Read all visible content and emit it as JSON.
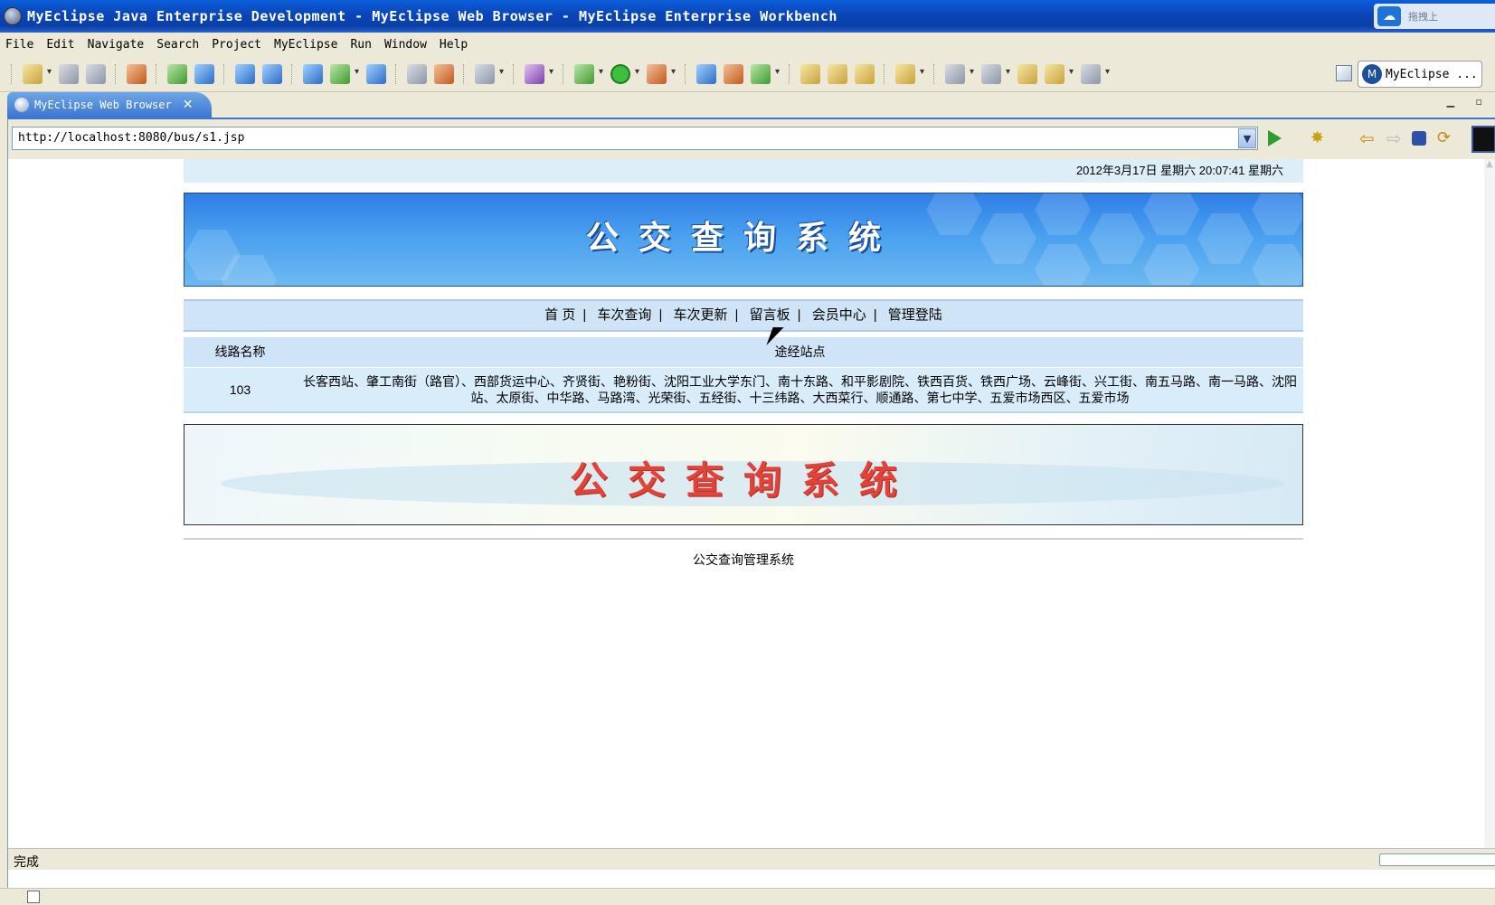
{
  "window": {
    "title": "MyEclipse Java Enterprise Development - MyEclipse Web Browser - MyEclipse Enterprise Workbench",
    "tray_text": "拖拽上"
  },
  "menu": [
    {
      "label": "File"
    },
    {
      "label": "Edit"
    },
    {
      "label": "Navigate"
    },
    {
      "label": "Search"
    },
    {
      "label": "Project"
    },
    {
      "label": "MyEclipse"
    },
    {
      "label": "Run"
    },
    {
      "label": "Window"
    },
    {
      "label": "Help"
    }
  ],
  "toolbar": {
    "perspective_label": "MyEclipse ...",
    "perspective_icon": "M"
  },
  "editor_tab": {
    "label": "MyEclipse Web Browser",
    "close": "✕"
  },
  "browser": {
    "url": "http://localhost:8080/bus/s1.jsp",
    "status": "完成"
  },
  "page": {
    "datetime": "2012年3月17日 星期六 20:07:41 星期六",
    "banner_title": "公交查询系统",
    "nav": [
      {
        "label": "首 页"
      },
      {
        "label": "车次查询"
      },
      {
        "label": "车次更新"
      },
      {
        "label": "留言板"
      },
      {
        "label": "会员中心"
      },
      {
        "label": "管理登陆"
      }
    ],
    "table": {
      "headers": [
        "线路名称",
        "途经站点"
      ],
      "rows": [
        {
          "name": "103",
          "stops": "长客西站、肇工南街（路官）、西部货运中心、齐贤街、艳粉街、沈阳工业大学东门、南十东路、和平影剧院、铁西百货、铁西广场、云峰街、兴工街、南五马路、南一马路、沈阳站、太原街、中华路、马路湾、光荣街、五经街、十三纬路、大西菜行、顺通路、第七中学、五爱市场西区、五爱市场"
        }
      ]
    },
    "banner2_title": "公交查询系统",
    "footer": "公交查询管理系统"
  },
  "colors": {
    "titlebar": "#0a44b8",
    "tab_active": "#3c76d0",
    "nav_bg": "#cfe4f6",
    "banner2_text": "#e0433a"
  }
}
